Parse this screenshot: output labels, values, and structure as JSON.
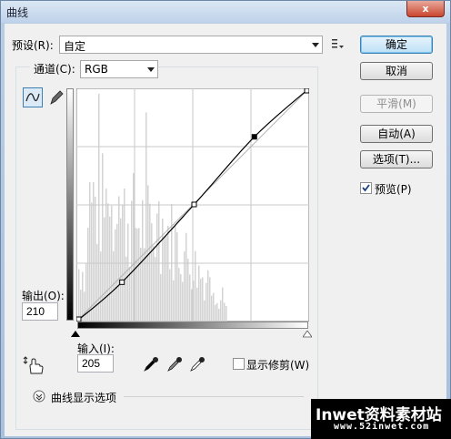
{
  "window": {
    "title": "曲线",
    "close_label": "x"
  },
  "preset": {
    "label": "预设(R):",
    "value": "自定"
  },
  "channel": {
    "label": "通道(C):",
    "value": "RGB"
  },
  "buttons": {
    "ok": "确定",
    "cancel": "取消",
    "smooth": "平滑(M)",
    "auto": "自动(A)",
    "options": "选项(T)..."
  },
  "preview": {
    "label": "预览(P)",
    "checked": true
  },
  "output": {
    "label": "输出(O):",
    "value": "210"
  },
  "input": {
    "label": "输入(I):",
    "value": "205"
  },
  "clipping": {
    "label": "显示修剪(W)",
    "checked": false
  },
  "curve_options": {
    "label": "曲线显示选项"
  },
  "curve": {
    "points": [
      [
        0,
        0
      ],
      [
        50,
        43
      ],
      [
        129,
        128
      ],
      [
        195,
        202
      ],
      [
        255,
        255
      ]
    ]
  },
  "watermark": {
    "main": "Inwet资料素材站",
    "sub": "www.52inwet.com"
  },
  "icons": [
    "curve-tool-icon",
    "pencil-tool-icon",
    "preset-menu-icon",
    "target-adjust-hand-icon",
    "eyedropper-black-icon",
    "eyedropper-gray-icon",
    "eyedropper-white-icon",
    "expand-chevron-icon"
  ]
}
